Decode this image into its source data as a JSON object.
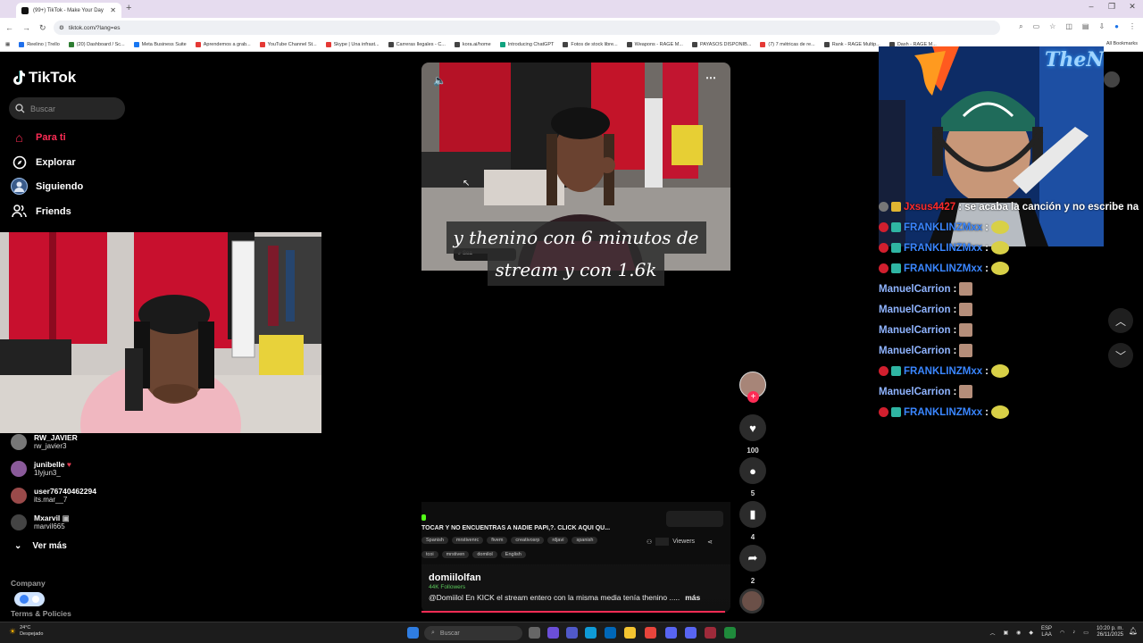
{
  "browser": {
    "tab_title": "(99+) TikTok - Make Your Day",
    "url": "tiktok.com/?lang=es",
    "new_tab_symbol": "+",
    "bookmarks": [
      {
        "label": "Reelino | Trello",
        "color": "#1f6feb"
      },
      {
        "label": "(20) Dashboard / Sc...",
        "color": "#2e7d32"
      },
      {
        "label": "Meta Business Suite",
        "color": "#1877f2"
      },
      {
        "label": "Aprendemos a grab...",
        "color": "#e53935"
      },
      {
        "label": "YouTube Channel St...",
        "color": "#e53935"
      },
      {
        "label": "Skype | Una infrast...",
        "color": "#e53935"
      },
      {
        "label": "Carreras Ilegales - C...",
        "color": "#444"
      },
      {
        "label": "kora.ai/home",
        "color": "#444"
      },
      {
        "label": "Introducing ChatGPT",
        "color": "#10a37f"
      },
      {
        "label": "Fotos de stock libre...",
        "color": "#444"
      },
      {
        "label": "Weapons - RAGE M...",
        "color": "#444"
      },
      {
        "label": "PAYASOS DISPONIB...",
        "color": "#444"
      },
      {
        "label": "(7) 7 métricas de re...",
        "color": "#e53935"
      },
      {
        "label": "Rank - RAGE Multip...",
        "color": "#444"
      },
      {
        "label": "Dash - RAGE M...",
        "color": "#444"
      }
    ],
    "all_bookmarks": "All Bookmarks"
  },
  "sidebar": {
    "logo": "TikTok",
    "search_placeholder": "Buscar",
    "nav": [
      {
        "label": "Para ti",
        "icon": "home-icon",
        "color": "#fe2c55"
      },
      {
        "label": "Explorar",
        "icon": "compass-icon",
        "color": "#ffffff"
      },
      {
        "label": "Siguiendo",
        "icon": "following-icon",
        "color": "#ffffff"
      },
      {
        "label": "Friends",
        "icon": "friends-icon",
        "color": "#ffffff"
      }
    ],
    "following": [
      {
        "name": "RW_JAVIER",
        "handle": "rw_javier3"
      },
      {
        "name": "junibelle",
        "handle": "1lyjun3_"
      },
      {
        "name": "user76740462294",
        "handle": "its.mar__7"
      },
      {
        "name": "Mxarvil",
        "handle": "marvil665"
      }
    ],
    "see_more": "Ver más",
    "footer": [
      "Company",
      "Terms & Policies"
    ]
  },
  "video": {
    "subtitle_line1": "y thenino con 6 minutos de",
    "subtitle_line2": "stream y con 1.6k",
    "stream_title": "TOCAR Y NO ENCUENTRAS A NADIE PAPI,?. CLICK AQUI QU...",
    "tags_row1": [
      "Spanish",
      "mrstivenrc",
      "fivem",
      "creativosrp",
      "rdjavi",
      "spanish"
    ],
    "tags_row2": [
      "tcoi",
      "mrstiven",
      "domilol",
      "English"
    ],
    "viewers_label": "Viewers",
    "author": "domiilolfan",
    "followers": "44K Followers",
    "description": "@Domiilol En KICK el stream entero con la misma media tenía thenino .....",
    "more": "más"
  },
  "actions": {
    "likes": "100",
    "comments": "5",
    "saves": "4",
    "shares": "2"
  },
  "chat": [
    {
      "user": "Jxsus4427",
      "color": "#ff2a2a",
      "text": " : se acaba la canción y no escribe na",
      "emote": false
    },
    {
      "user": "FRANKLINZMxx",
      "color": "#3a86ff",
      "text": " :",
      "emote": true
    },
    {
      "user": "FRANKLINZMxx",
      "color": "#3a86ff",
      "text": " :",
      "emote": true
    },
    {
      "user": "FRANKLINZMxx",
      "color": "#3a86ff",
      "text": " :",
      "emote": true
    },
    {
      "user": "ManuelCarrion",
      "color": "#8fb4ff",
      "text": " :",
      "emote": true
    },
    {
      "user": "ManuelCarrion",
      "color": "#8fb4ff",
      "text": " :",
      "emote": true
    },
    {
      "user": "ManuelCarrion",
      "color": "#8fb4ff",
      "text": " :",
      "emote": true
    },
    {
      "user": "ManuelCarrion",
      "color": "#8fb4ff",
      "text": " :",
      "emote": true
    },
    {
      "user": "FRANKLINZMxx",
      "color": "#3a86ff",
      "text": " :",
      "emote": true
    },
    {
      "user": "ManuelCarrion",
      "color": "#8fb4ff",
      "text": " :",
      "emote": true
    },
    {
      "user": "FRANKLINZMxx",
      "color": "#3a86ff",
      "text": " :",
      "emote": true
    }
  ],
  "webcam_right_label": "TheNino",
  "taskbar": {
    "temp": "24°C",
    "weather": "Despejado",
    "search": "Buscar",
    "lang": "ESP",
    "lang2": "LAA",
    "time": "10:20 p. m.",
    "date": "26/11/2025"
  }
}
